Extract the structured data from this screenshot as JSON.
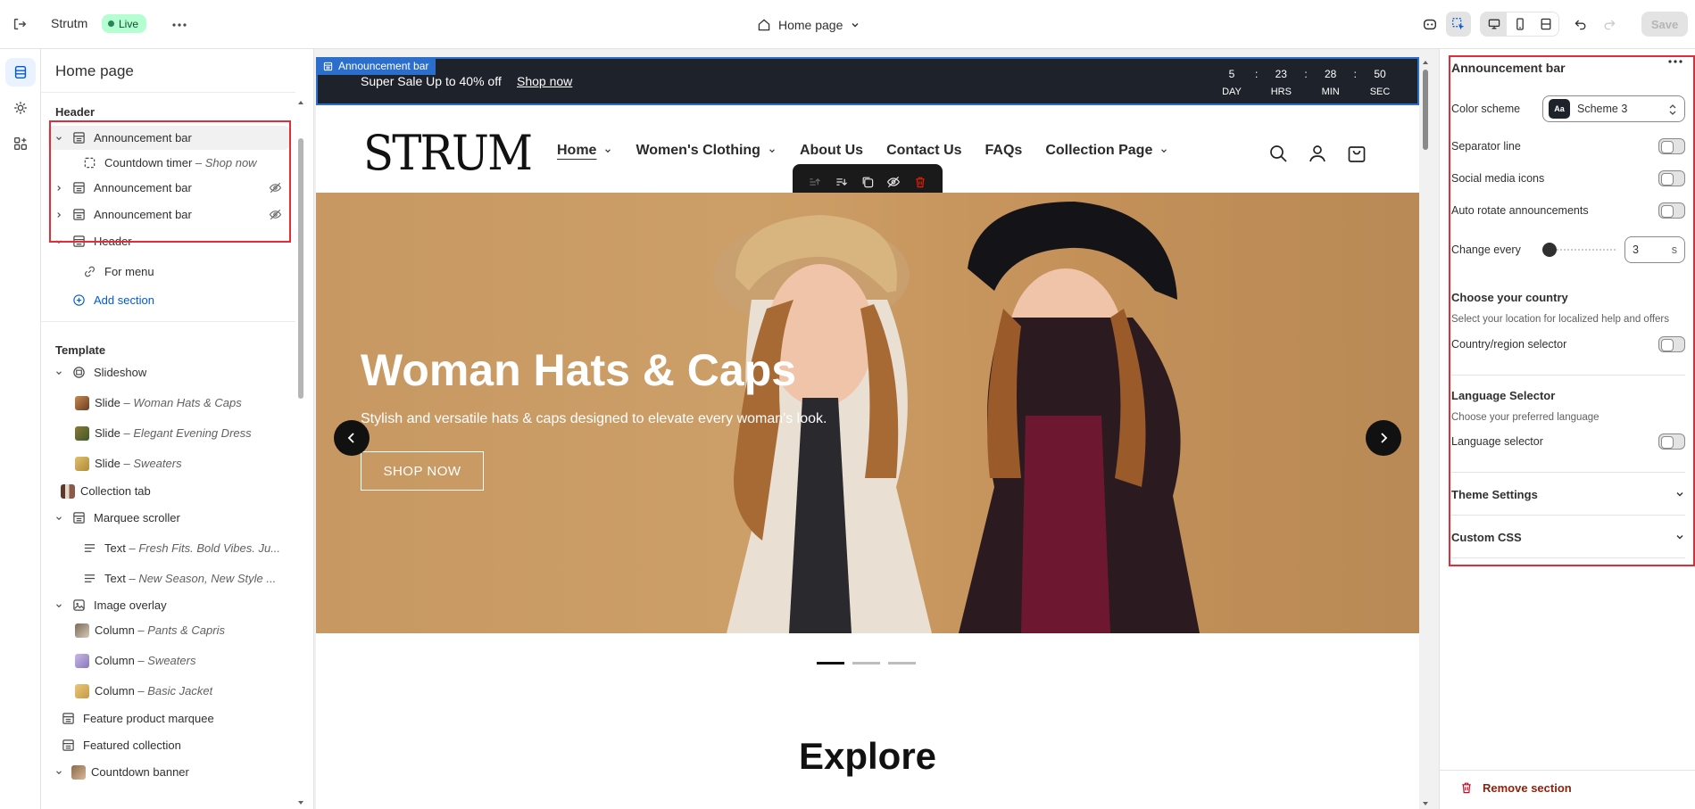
{
  "topbar": {
    "store_name": "Strutm",
    "status_badge": "Live",
    "page_selector": "Home page",
    "save_label": "Save"
  },
  "left_panel": {
    "title": "Home page",
    "header_group": "Header",
    "header_items": [
      {
        "label": "Announcement bar",
        "hidden": false,
        "selected": true
      },
      {
        "label": "Countdown timer",
        "detail": "Shop now"
      },
      {
        "label": "Announcement bar",
        "hidden": true
      },
      {
        "label": "Announcement bar",
        "hidden": true
      },
      {
        "label": "Header"
      },
      {
        "label": "For menu"
      },
      {
        "label": "Add section"
      }
    ],
    "template_group": "Template",
    "template_items": [
      {
        "label": "Slideshow"
      },
      {
        "label": "Slide",
        "detail": "Woman Hats & Caps"
      },
      {
        "label": "Slide",
        "detail": "Elegant Evening Dress"
      },
      {
        "label": "Slide",
        "detail": "Sweaters"
      },
      {
        "label": "Collection tab"
      },
      {
        "label": "Marquee scroller"
      },
      {
        "label": "Text",
        "detail": "Fresh Fits. Bold Vibes. Ju..."
      },
      {
        "label": "Text",
        "detail": "New Season, New Style ..."
      },
      {
        "label": "Image overlay"
      },
      {
        "label": "Column",
        "detail": "Pants & Capris"
      },
      {
        "label": "Column",
        "detail": "Sweaters"
      },
      {
        "label": "Column",
        "detail": "Basic Jacket"
      },
      {
        "label": "Feature product marquee"
      },
      {
        "label": "Featured collection"
      },
      {
        "label": "Countdown banner"
      }
    ],
    "separator": " – "
  },
  "preview": {
    "section_tag": "Announcement bar",
    "announcement_text": "Super Sale Up to 40% off",
    "announcement_link": "Shop now",
    "countdown": [
      {
        "value": "5",
        "label": "DAY"
      },
      {
        "value": "23",
        "label": "HRS"
      },
      {
        "value": "28",
        "label": "MIN"
      },
      {
        "value": "50",
        "label": "SEC"
      }
    ],
    "countdown_sep": ":",
    "logo": "STRUM",
    "nav": [
      {
        "label": "Home",
        "dropdown": true,
        "active": true
      },
      {
        "label": "Women's Clothing",
        "dropdown": true
      },
      {
        "label": "About Us",
        "dropdown": false
      },
      {
        "label": "Contact Us",
        "dropdown": false
      },
      {
        "label": "FAQs",
        "dropdown": false
      },
      {
        "label": "Collection Page",
        "dropdown": true
      }
    ],
    "hero_title": "Woman Hats & Caps",
    "hero_subtitle": "Stylish and versatile hats & caps designed to elevate every woman's look.",
    "hero_button": "SHOP NOW",
    "explore_heading": "Explore"
  },
  "right_panel": {
    "title": "Announcement bar",
    "color_scheme_label": "Color scheme",
    "color_scheme_value": "Scheme 3",
    "swatch_text": "Aa",
    "separator_line": "Separator line",
    "social_media_icons": "Social media icons",
    "auto_rotate": "Auto rotate announcements",
    "change_every": "Change every",
    "change_every_value": "3",
    "change_every_suffix": "s",
    "country_heading": "Choose your country",
    "country_help": "Select your location for localized help and offers",
    "country_selector": "Country/region selector",
    "language_heading": "Language Selector",
    "language_help": "Choose your preferred language",
    "language_selector": "Language selector",
    "theme_settings": "Theme Settings",
    "custom_css": "Custom CSS",
    "remove_section": "Remove section"
  },
  "colors": {
    "accent": "#005bd3",
    "highlight": "#e22c38",
    "announcement_bg": "#1e222a",
    "live_badge": "#b4fed2"
  }
}
